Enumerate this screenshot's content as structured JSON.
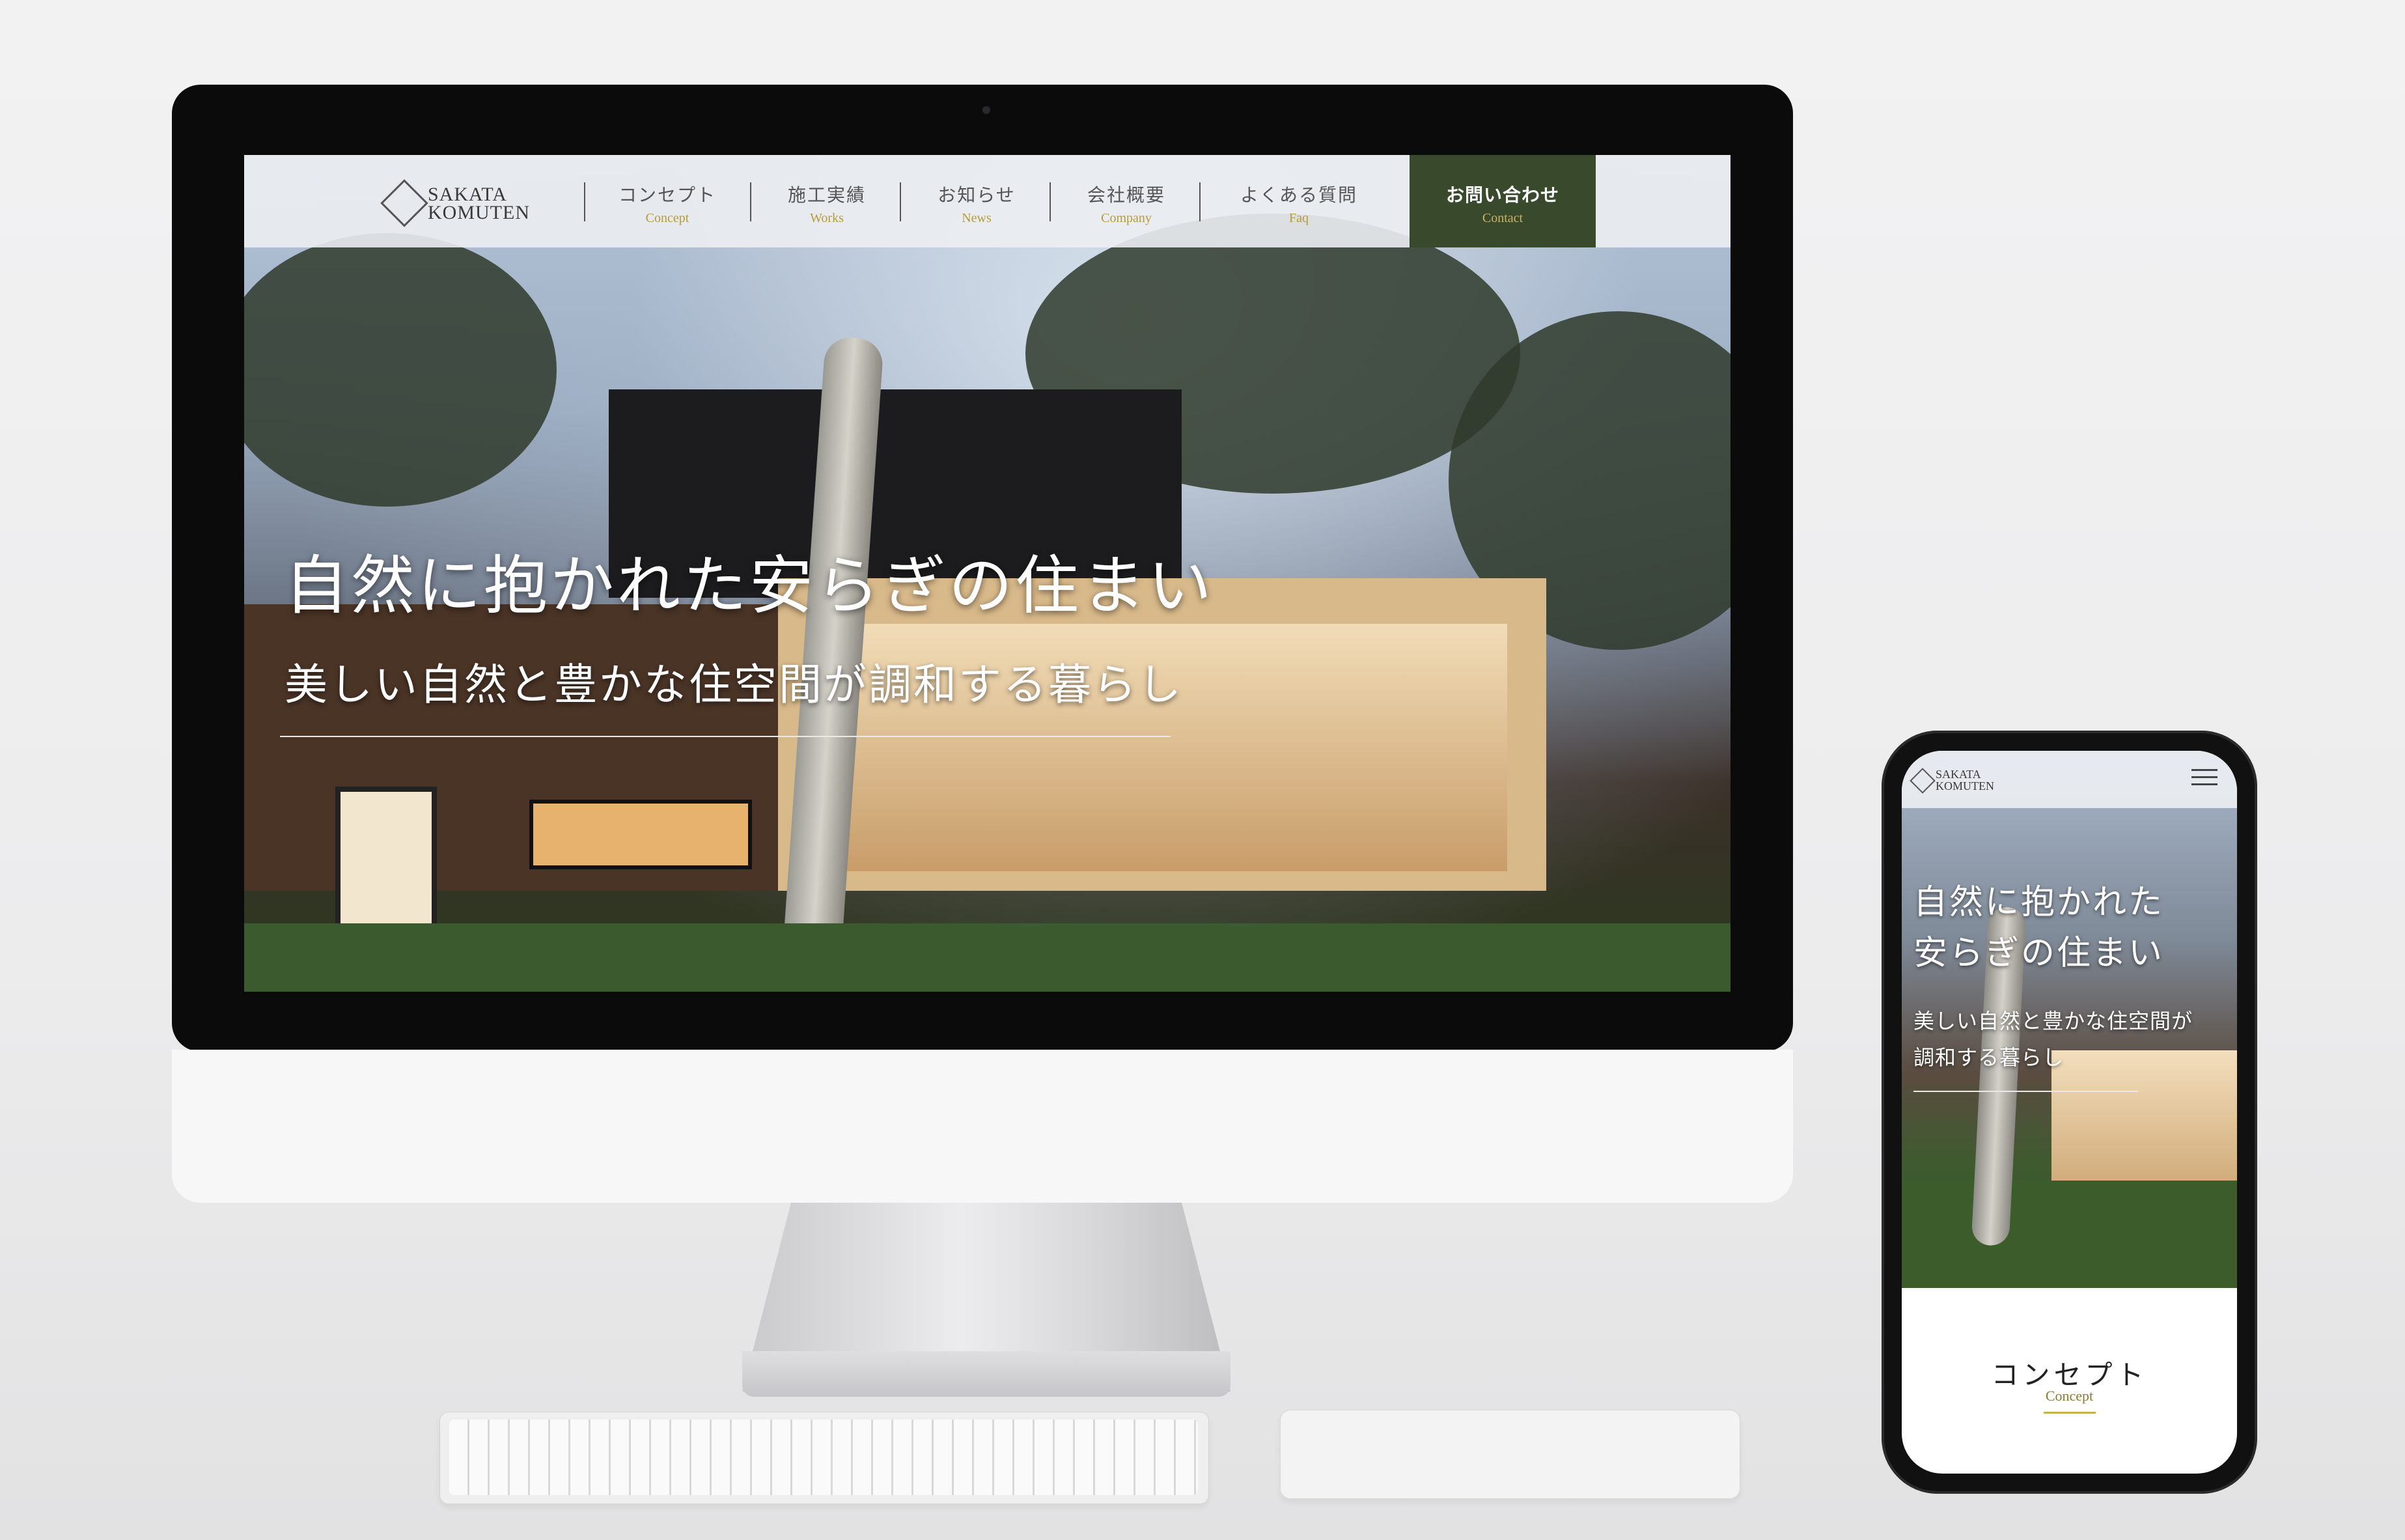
{
  "site": {
    "logo": {
      "line1": "SAKATA",
      "line2": "KOMUTEN"
    },
    "nav": [
      {
        "jp": "コンセプト",
        "en": "Concept"
      },
      {
        "jp": "施工実績",
        "en": "Works"
      },
      {
        "jp": "お知らせ",
        "en": "News"
      },
      {
        "jp": "会社概要",
        "en": "Company"
      },
      {
        "jp": "よくある質問",
        "en": "Faq"
      }
    ],
    "contact": {
      "jp": "お問い合わせ",
      "en": "Contact"
    }
  },
  "desktop": {
    "hero_title": "自然に抱かれた安らぎの住まい",
    "hero_subtitle": "美しい自然と豊かな住空間が調和する暮らし"
  },
  "mobile": {
    "hero_title_line1": "自然に抱かれた",
    "hero_title_line2": "安らぎの住まい",
    "hero_sub_line1": "美しい自然と豊かな住空間が",
    "hero_sub_line2": "調和する暮らし",
    "concept_title": "コンセプト",
    "concept_en": "Concept"
  },
  "colors": {
    "accent_green": "#384a2b",
    "accent_gold": "#b79a3c"
  },
  "icons": [
    "diamond-logo-icon",
    "hamburger-menu-icon"
  ]
}
